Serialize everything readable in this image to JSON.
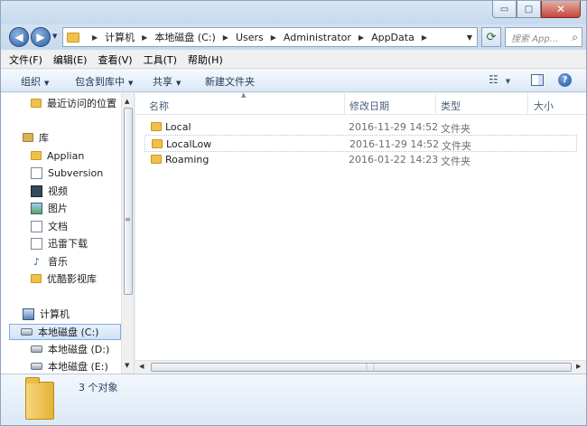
{
  "window": {
    "controls": {
      "minimize": "▭",
      "maximize": "□",
      "close": "✕"
    }
  },
  "address": {
    "crumbs": [
      "计算机",
      "本地磁盘 (C:)",
      "Users",
      "Administrator",
      "AppData"
    ],
    "search_placeholder": "搜索 App..."
  },
  "menu": [
    "文件(F)",
    "编辑(E)",
    "查看(V)",
    "工具(T)",
    "帮助(H)"
  ],
  "toolbar": {
    "organize": "组织",
    "include_library": "包含到库中",
    "share": "共享",
    "new_folder": "新建文件夹"
  },
  "nav_pane": {
    "recent": "最近访问的位置",
    "libraries_header": "库",
    "libraries": [
      "Applian",
      "Subversion",
      "视频",
      "图片",
      "文档",
      "迅雷下载",
      "音乐",
      "优酷影视库"
    ],
    "computer_header": "计算机",
    "drives": [
      "本地磁盘 (C:)",
      "本地磁盘 (D:)",
      "本地磁盘 (E:)"
    ]
  },
  "columns": {
    "name": "名称",
    "date": "修改日期",
    "type": "类型",
    "size": "大小"
  },
  "files": [
    {
      "name": "Local",
      "date": "2016-11-29 14:52",
      "type": "文件夹"
    },
    {
      "name": "LocalLow",
      "date": "2016-11-29 14:52",
      "type": "文件夹"
    },
    {
      "name": "Roaming",
      "date": "2016-01-22 14:23",
      "type": "文件夹"
    }
  ],
  "status": {
    "count": "3 个对象"
  }
}
